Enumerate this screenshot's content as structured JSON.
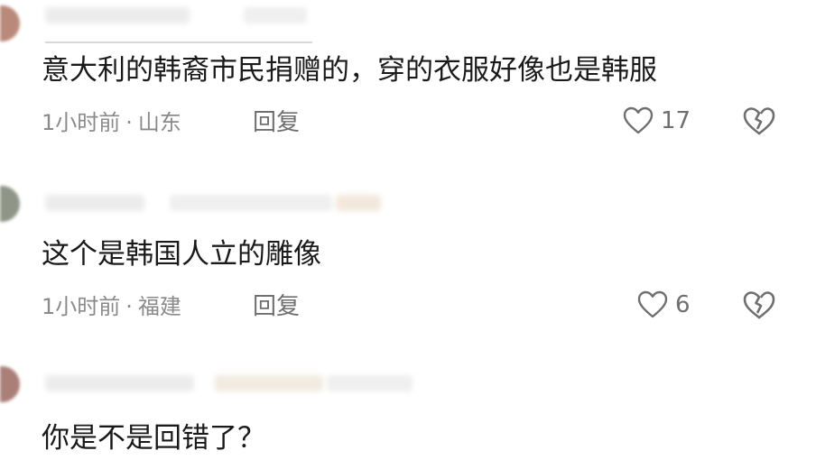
{
  "comments": [
    {
      "text": "意大利的韩裔市民捐赠的，穿的衣服好像也是韩服",
      "time": "1小时前",
      "separator": "·",
      "location": "山东",
      "reply_label": "回复",
      "like_count": "17",
      "like_icon": "heart-outline-icon",
      "dislike_icon": "broken-heart-icon"
    },
    {
      "text": "这个是韩国人立的雕像",
      "time": "1小时前",
      "separator": "·",
      "location": "福建",
      "reply_label": "回复",
      "like_count": "6",
      "like_icon": "heart-outline-icon",
      "dislike_icon": "broken-heart-icon"
    },
    {
      "text": "你是不是回错了？"
    }
  ],
  "colors": {
    "text": "#1a1a1a",
    "meta": "#8a8a8a",
    "icon": "#6f6f6f",
    "avatar_1": "#b98a7a",
    "avatar_2": "#8f9687",
    "avatar_3": "#a97f78"
  }
}
